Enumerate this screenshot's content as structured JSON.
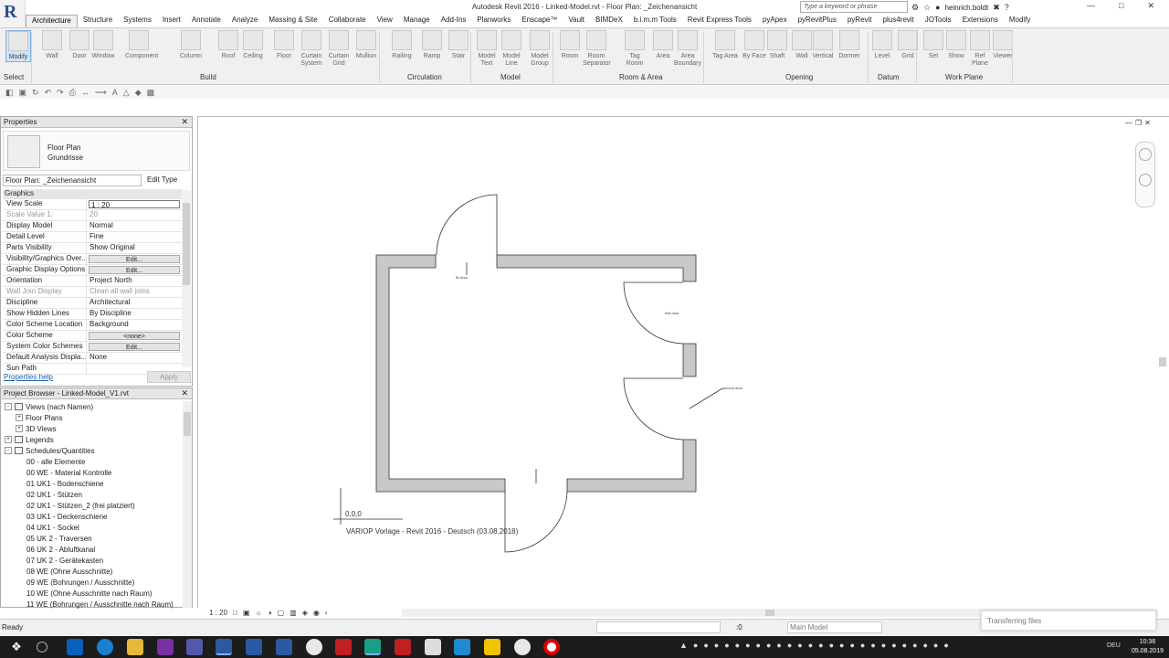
{
  "app_title": "Autodesk Revit 2016 -    Linked-Model.rvt - Floor Plan: _Zeichenansicht",
  "search_placeholder": "Type a keyword or phrase",
  "user": "heinrich.boldt",
  "tabs": [
    "Architecture",
    "Structure",
    "Systems",
    "Insert",
    "Annotate",
    "Analyze",
    "Massing & Site",
    "Collaborate",
    "View",
    "Manage",
    "Add-Ins",
    "Planworks",
    "Enscape™",
    "Vault",
    "BIMDeX",
    "b.i.m.m Tools",
    "Revit Express Tools",
    "pyApex",
    "pyRevitPlus",
    "pyRevit",
    "plus4revit",
    "JOTools",
    "Extensions",
    "Modify"
  ],
  "ribbon": {
    "buttons": [
      {
        "label": "Modify"
      },
      {
        "label": "Wall"
      },
      {
        "label": "Door"
      },
      {
        "label": "Window"
      },
      {
        "label": "Component"
      },
      {
        "label": "Column"
      },
      {
        "label": "Roof"
      },
      {
        "label": "Ceiling"
      },
      {
        "label": "Floor"
      },
      {
        "label": "Curtain System"
      },
      {
        "label": "Curtain Grid"
      },
      {
        "label": "Mullion"
      },
      {
        "label": "Railing"
      },
      {
        "label": "Ramp"
      },
      {
        "label": "Stair"
      },
      {
        "label": "Model Text"
      },
      {
        "label": "Model Line"
      },
      {
        "label": "Model Group"
      },
      {
        "label": "Room"
      },
      {
        "label": "Room Separator"
      },
      {
        "label": "Tag Room"
      },
      {
        "label": "Area"
      },
      {
        "label": "Area Boundary"
      },
      {
        "label": "Tag Area"
      },
      {
        "label": "By Face"
      },
      {
        "label": "Shaft"
      },
      {
        "label": "Wall"
      },
      {
        "label": "Vertical"
      },
      {
        "label": "Dormer"
      },
      {
        "label": "Level"
      },
      {
        "label": "Grid"
      },
      {
        "label": "Set"
      },
      {
        "label": "Show"
      },
      {
        "label": "Ref Plane"
      },
      {
        "label": "Viewer"
      }
    ],
    "panels": [
      "Select",
      "Build",
      "Circulation",
      "Model",
      "Room & Area",
      "Opening",
      "Datum",
      "Work Plane"
    ]
  },
  "properties": {
    "title": "Properties",
    "type_line1": "Floor Plan",
    "type_line2": "Grundrisse",
    "instance_combo": "Floor Plan: _Zeichenansicht",
    "edit_type": "Edit Type",
    "group": "Graphics",
    "rows": [
      {
        "k": "View Scale",
        "v": "1 : 20"
      },
      {
        "k": "Scale Value    1:",
        "v": "20"
      },
      {
        "k": "Display Model",
        "v": "Normal"
      },
      {
        "k": "Detail Level",
        "v": "Fine"
      },
      {
        "k": "Parts Visibility",
        "v": "Show Original"
      },
      {
        "k": "Visibility/Graphics Over...",
        "v": "Edit..."
      },
      {
        "k": "Graphic Display Options",
        "v": "Edit..."
      },
      {
        "k": "Orientation",
        "v": "Project North"
      },
      {
        "k": "Wall Join Display",
        "v": "Clean all wall joins"
      },
      {
        "k": "Discipline",
        "v": "Architectural"
      },
      {
        "k": "Show Hidden Lines",
        "v": "By Discipline"
      },
      {
        "k": "Color Scheme Location",
        "v": "Background"
      },
      {
        "k": "Color Scheme",
        "v": "<none>"
      },
      {
        "k": "System Color Schemes",
        "v": "Edit..."
      },
      {
        "k": "Default Analysis Displa...",
        "v": "None"
      },
      {
        "k": "Sun Path",
        "v": ""
      }
    ],
    "help_link": "Properties help",
    "apply": "Apply"
  },
  "browser": {
    "title": "Project Browser - Linked-Model_V1.rvt",
    "items": [
      "Views (nach Namen)",
      "Floor Plans",
      "3D Views",
      "Legends",
      "Schedules/Quantities",
      "00 - alle Elemente",
      "00 WE - Material Kontrolle",
      "01 UK1 - Bodenschiene",
      "02 UK1 - Stützen",
      "02 UK1 - Stützen_2 (frei platziert)",
      "03 UK1 - Deckenschiene",
      "04 UK1 - Sockel",
      "05 UK 2 - Traversen",
      "06 UK 2 - Abluftkanal",
      "07 UK 2 - Gerätekasten",
      "08 WE (Ohne Ausschnitte)",
      "09 WE (Bohrungen / Ausschnitte)",
      "10 WE (Ohne Ausschnitte nach Raum)",
      "11 WE (Bohrungen / Ausschnitte nach Raum)"
    ]
  },
  "drawing": {
    "tag_fix_door": "fix door",
    "tag_first_door": "first door",
    "tag_second_door": "second door",
    "origin": "0,0,0",
    "footer_text": "VARIOP Vorlage    - Revit 2016    - Deutsch (03.08.2018)"
  },
  "view_scale": "1 : 20",
  "status": "Ready",
  "status_zero": ":0",
  "main_model": "Main Model",
  "toast": "Transferring files",
  "clock_time": "10:36",
  "clock_date": "05.08.2019",
  "lang": "DEU"
}
